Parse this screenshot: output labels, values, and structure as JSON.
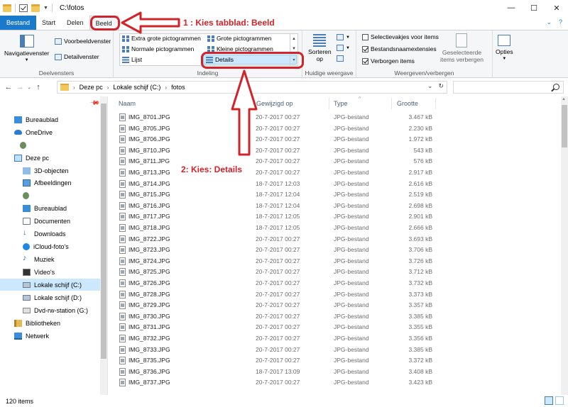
{
  "window": {
    "title": "C:\\fotos"
  },
  "tabs": [
    {
      "label": "Bestand"
    },
    {
      "label": "Start"
    },
    {
      "label": "Delen"
    },
    {
      "label": "Beeld"
    }
  ],
  "ribbon": {
    "panes": {
      "nav_pane_label": "Navigatievenster",
      "preview_label": "Voorbeeldvenster",
      "details_pane_label": "Detailvenster",
      "group_label": "Deelvensters"
    },
    "layout": {
      "extra_large": "Extra grote pictogrammen",
      "large": "Grote pictogrammen",
      "medium": "Normale pictogrammen",
      "small": "Kleine pictogrammen",
      "list": "Lijst",
      "details": "Details",
      "group_label": "Indeling"
    },
    "current_view": {
      "sort_label_1": "Sorteren",
      "sort_label_2": "op",
      "group_label": "Huidige weergave"
    },
    "show_hide": {
      "checkboxes": [
        {
          "label": "Selectievakjes voor items",
          "checked": false
        },
        {
          "label": "Bestandsnaamextensies",
          "checked": true
        },
        {
          "label": "Verborgen items",
          "checked": true
        }
      ],
      "hide_selected_1": "Geselecteerde",
      "hide_selected_2": "items verbergen",
      "group_label": "Weergeven/verbergen"
    },
    "options_label": "Opties"
  },
  "address": {
    "crumbs": [
      "Deze pc",
      "Lokale schijf (C:)",
      "fotos"
    ]
  },
  "nav": {
    "items": [
      {
        "label": "Bureaublad",
        "icon": "desktop-icon"
      },
      {
        "label": "OneDrive",
        "icon": "onedrive-icon"
      },
      {
        "label": "",
        "icon": "user-icon"
      },
      {
        "label": "Deze pc",
        "icon": "pc-icon"
      },
      {
        "label": "3D-objecten",
        "icon": "3d-objects-icon"
      },
      {
        "label": "Afbeeldingen",
        "icon": "pictures-icon"
      },
      {
        "label": "",
        "icon": "user-folder-icon"
      },
      {
        "label": "Bureaublad",
        "icon": "desktop-icon"
      },
      {
        "label": "Documenten",
        "icon": "documents-icon"
      },
      {
        "label": "Downloads",
        "icon": "downloads-icon"
      },
      {
        "label": "iCloud-foto's",
        "icon": "icloud-icon"
      },
      {
        "label": "Muziek",
        "icon": "music-icon"
      },
      {
        "label": "Video's",
        "icon": "videos-icon"
      },
      {
        "label": "Lokale schijf (C:)",
        "icon": "drive-icon"
      },
      {
        "label": "Lokale schijf (D:)",
        "icon": "drive-icon"
      },
      {
        "label": "Dvd-rw-station (G:)",
        "icon": "dvd-icon"
      },
      {
        "label": "Bibliotheken",
        "icon": "libraries-icon"
      },
      {
        "label": "Netwerk",
        "icon": "network-icon"
      }
    ]
  },
  "columns": {
    "name": "Naam",
    "modified": "Gewijzigd op",
    "type": "Type",
    "size": "Grootte"
  },
  "files": [
    {
      "name": "IMG_8701.JPG",
      "date": "20-7-2017 00:27",
      "type": "JPG-bestand",
      "size": "3.467 kB"
    },
    {
      "name": "IMG_8705.JPG",
      "date": "20-7-2017 00:27",
      "type": "JPG-bestand",
      "size": "2.230 kB"
    },
    {
      "name": "IMG_8706.JPG",
      "date": "20-7-2017 00:27",
      "type": "JPG-bestand",
      "size": "1.972 kB"
    },
    {
      "name": "IMG_8710.JPG",
      "date": "20-7-2017 00:27",
      "type": "JPG-bestand",
      "size": "543 kB"
    },
    {
      "name": "IMG_8711.JPG",
      "date": "20-7-2017 00:27",
      "type": "JPG-bestand",
      "size": "576 kB"
    },
    {
      "name": "IMG_8713.JPG",
      "date": "20-7-2017 00:27",
      "type": "JPG-bestand",
      "size": "2.917 kB"
    },
    {
      "name": "IMG_8714.JPG",
      "date": "18-7-2017 12:03",
      "type": "JPG-bestand",
      "size": "2.616 kB"
    },
    {
      "name": "IMG_8715.JPG",
      "date": "18-7-2017 12:04",
      "type": "JPG-bestand",
      "size": "2.519 kB"
    },
    {
      "name": "IMG_8716.JPG",
      "date": "18-7-2017 12:04",
      "type": "JPG-bestand",
      "size": "2.698 kB"
    },
    {
      "name": "IMG_8717.JPG",
      "date": "18-7-2017 12:05",
      "type": "JPG-bestand",
      "size": "2.901 kB"
    },
    {
      "name": "IMG_8718.JPG",
      "date": "18-7-2017 12:05",
      "type": "JPG-bestand",
      "size": "2.666 kB"
    },
    {
      "name": "IMG_8722.JPG",
      "date": "20-7-2017 00:27",
      "type": "JPG-bestand",
      "size": "3.693 kB"
    },
    {
      "name": "IMG_8723.JPG",
      "date": "20-7-2017 00:27",
      "type": "JPG-bestand",
      "size": "3.706 kB"
    },
    {
      "name": "IMG_8724.JPG",
      "date": "20-7-2017 00:27",
      "type": "JPG-bestand",
      "size": "3.726 kB"
    },
    {
      "name": "IMG_8725.JPG",
      "date": "20-7-2017 00:27",
      "type": "JPG-bestand",
      "size": "3.712 kB"
    },
    {
      "name": "IMG_8726.JPG",
      "date": "20-7-2017 00:27",
      "type": "JPG-bestand",
      "size": "3.732 kB"
    },
    {
      "name": "IMG_8728.JPG",
      "date": "20-7-2017 00:27",
      "type": "JPG-bestand",
      "size": "3.373 kB"
    },
    {
      "name": "IMG_8729.JPG",
      "date": "20-7-2017 00:27",
      "type": "JPG-bestand",
      "size": "3.357 kB"
    },
    {
      "name": "IMG_8730.JPG",
      "date": "20-7-2017 00:27",
      "type": "JPG-bestand",
      "size": "3.385 kB"
    },
    {
      "name": "IMG_8731.JPG",
      "date": "20-7-2017 00:27",
      "type": "JPG-bestand",
      "size": "3.355 kB"
    },
    {
      "name": "IMG_8732.JPG",
      "date": "20-7-2017 00:27",
      "type": "JPG-bestand",
      "size": "3.356 kB"
    },
    {
      "name": "IMG_8733.JPG",
      "date": "20-7-2017 00:27",
      "type": "JPG-bestand",
      "size": "3.385 kB"
    },
    {
      "name": "IMG_8735.JPG",
      "date": "20-7-2017 00:27",
      "type": "JPG-bestand",
      "size": "3.372 kB"
    },
    {
      "name": "IMG_8736.JPG",
      "date": "18-7-2017 13:09",
      "type": "JPG-bestand",
      "size": "3.408 kB"
    },
    {
      "name": "IMG_8737.JPG",
      "date": "20-7-2017 00:27",
      "type": "JPG-bestand",
      "size": "3.423 kB"
    }
  ],
  "status": {
    "count": "120 items"
  },
  "annotations": {
    "step1": "1 : Kies tabblad: Beeld",
    "step2": "2:  Kies:   Details",
    "color": "#d2232a"
  }
}
